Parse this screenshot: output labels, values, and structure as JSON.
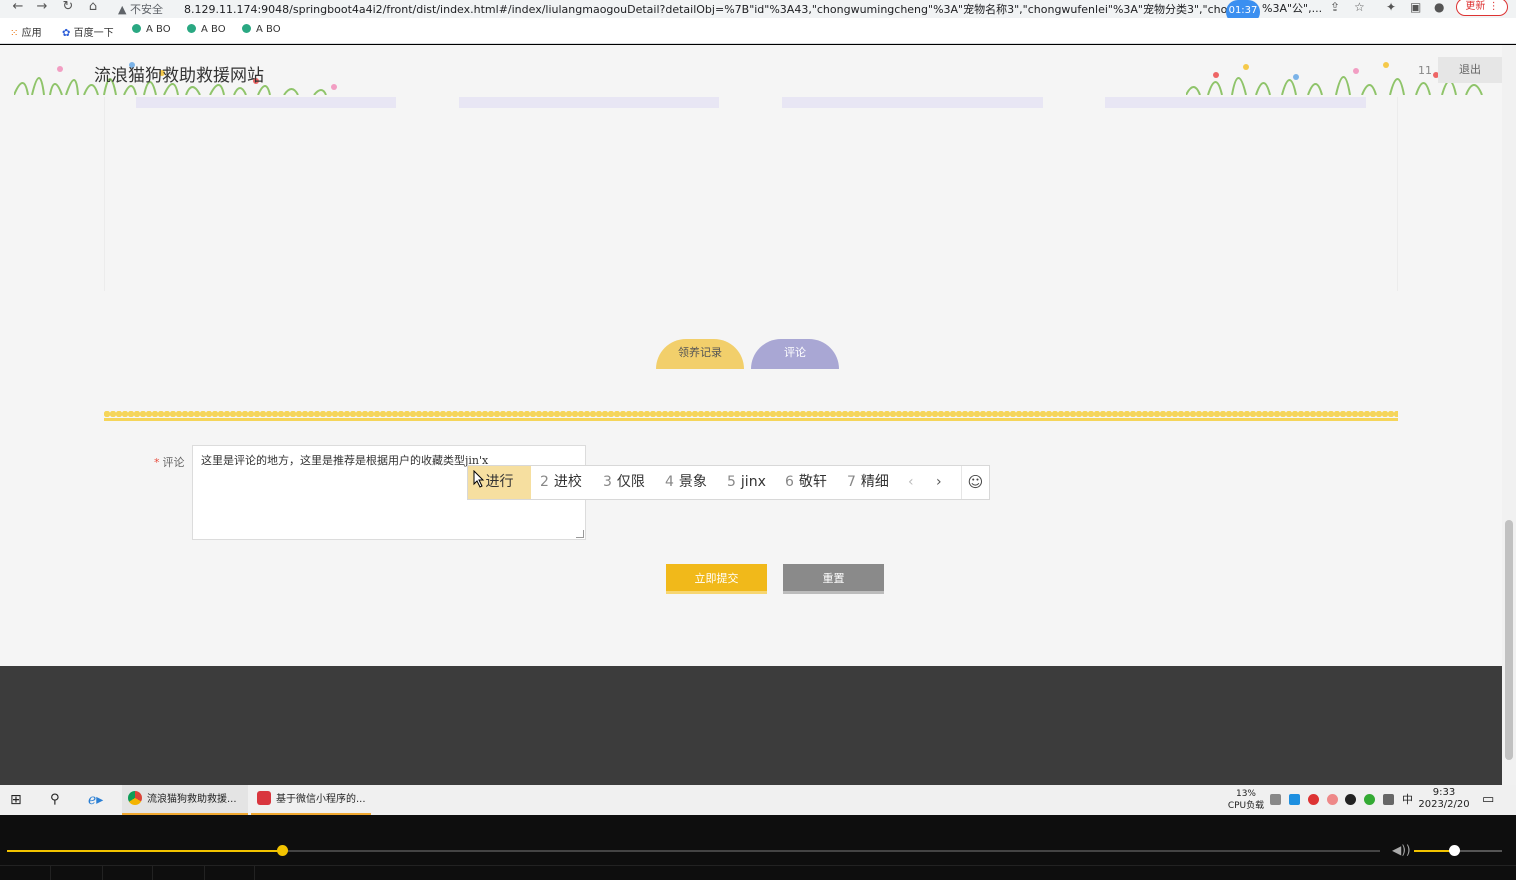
{
  "browser": {
    "security_label": "不安全",
    "url": "8.129.11.174:9048/springboot4a4i2/front/dist/index.html#/index/liulangmaogouDetail?detailObj=%7B\"id\"%3A43,\"chongwumingcheng\"%3A\"宠物名称3\",\"chongwufenlei\"%3A\"宠物分类3\",\"chongwu",
    "url_tail": "%3A\"公\",...",
    "timer": "01:37",
    "update_label": "更新",
    "bookmarks": [
      "应用",
      "百度一下",
      "A BO",
      "A BO",
      "A BO"
    ]
  },
  "header": {
    "site_title": "流浪猫狗救助救援网站",
    "user_count": "11",
    "logout_label": "退出"
  },
  "tabs": {
    "adopt_label": "领养记录",
    "comment_label": "评论"
  },
  "form": {
    "comment_label": "评论",
    "comment_text": "这里是评论的地方，这里是推荐是根据用户的收藏类型",
    "ime_composition": "jin'x"
  },
  "ime": {
    "candidates": [
      {
        "num": "1",
        "text": "进行"
      },
      {
        "num": "2",
        "text": "进校"
      },
      {
        "num": "3",
        "text": "仅限"
      },
      {
        "num": "4",
        "text": "景象"
      },
      {
        "num": "5",
        "text": "jinx"
      },
      {
        "num": "6",
        "text": "敬轩"
      },
      {
        "num": "7",
        "text": "精细"
      }
    ],
    "prev_symbol": "‹",
    "next_symbol": "›",
    "emoji_symbol": "☺"
  },
  "buttons": {
    "submit_label": "立即提交",
    "reset_label": "重置"
  },
  "taskbar": {
    "apps": [
      "流浪猫狗救助救援...",
      "基于微信小程序的..."
    ],
    "cpu_percent": "13%",
    "cpu_label": "CPU负载",
    "ime_indicator": "中",
    "time": "9:33",
    "date": "2023/2/20"
  },
  "player": {
    "progress": 0.2,
    "volume": 0.45
  }
}
